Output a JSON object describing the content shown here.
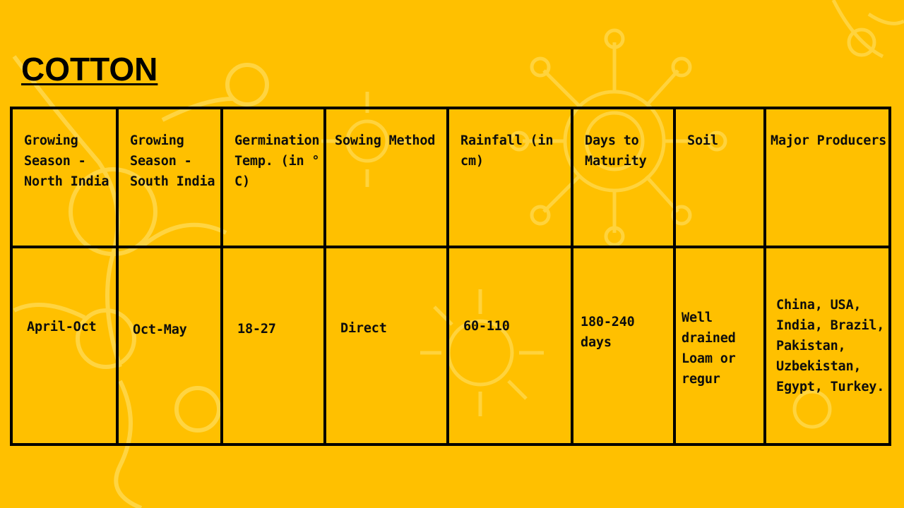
{
  "slide": {
    "title": "COTTON",
    "accent_color": "#FFC000"
  },
  "table": {
    "headers": [
      "Growing Season - North India",
      "Growing Season - South India",
      "Germination Temp. (in ° C)",
      "Sowing Method",
      "Rainfall (in cm)",
      "Days to Maturity",
      "Soil",
      "Major Producers"
    ],
    "values": [
      "April-Oct",
      "Oct-May",
      "18-27",
      "Direct",
      "60-110",
      "180-240 days",
      "Well drained Loam or regur",
      "China, USA, India, Brazil, Pakistan, Uzbekistan, Egypt, Turkey."
    ]
  }
}
